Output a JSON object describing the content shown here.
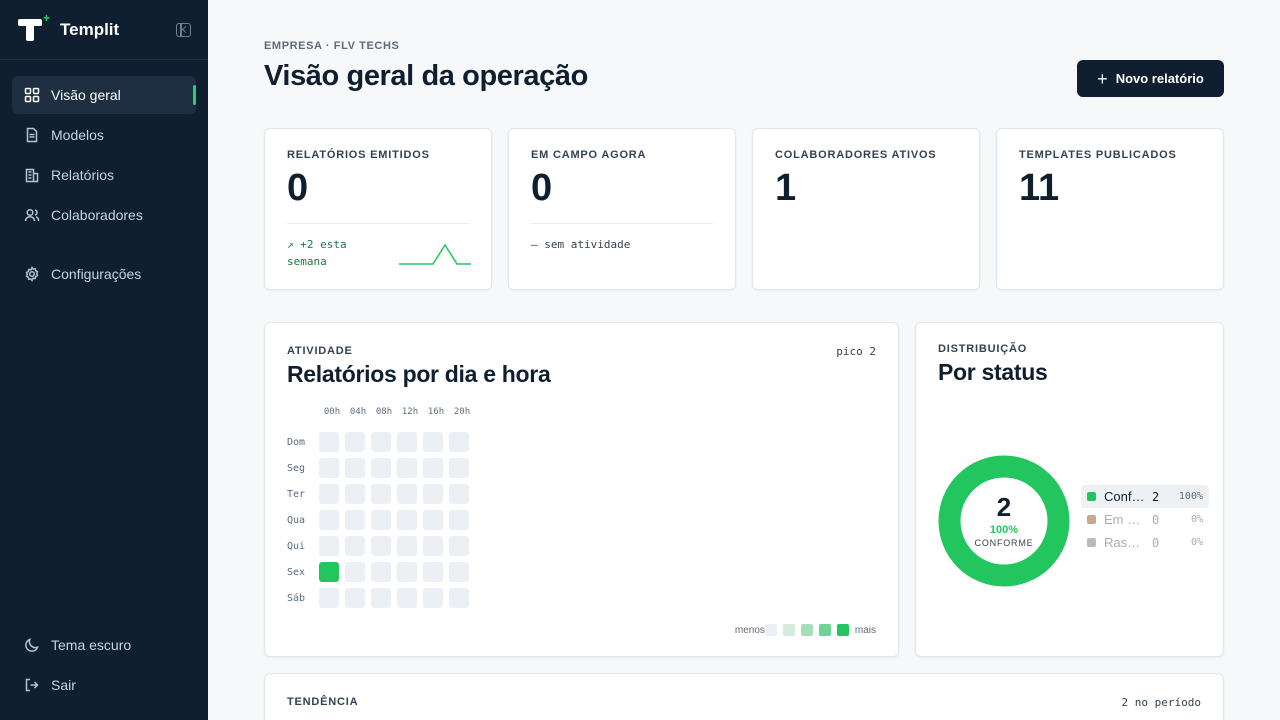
{
  "brand": {
    "name": "Templit"
  },
  "sidebar": {
    "items": [
      {
        "label": "Visão geral",
        "icon": "grid-icon",
        "active": true
      },
      {
        "label": "Modelos",
        "icon": "document-icon"
      },
      {
        "label": "Relatórios",
        "icon": "building-icon"
      },
      {
        "label": "Colaboradores",
        "icon": "users-icon"
      },
      {
        "label": "Configurações",
        "icon": "gear-icon"
      }
    ],
    "bottom": [
      {
        "label": "Tema escuro",
        "icon": "moon-icon"
      },
      {
        "label": "Sair",
        "icon": "logout-icon"
      }
    ]
  },
  "header": {
    "breadcrumb": "EMPRESA · FLV TECHS",
    "title": "Visão geral da operação",
    "new_button": "Novo relatório"
  },
  "kpis": [
    {
      "label": "RELATÓRIOS EMITIDOS",
      "value": "0",
      "foot": "↗ +2 esta semana"
    },
    {
      "label": "EM CAMPO AGORA",
      "value": "0",
      "foot": "— sem atividade"
    },
    {
      "label": "COLABORADORES ATIVOS",
      "value": "1"
    },
    {
      "label": "TEMPLATES PUBLICADOS",
      "value": "11"
    }
  ],
  "activity": {
    "label": "ATIVIDADE",
    "title": "Relatórios por dia e hora",
    "peak": "pico 2",
    "hours": [
      "00h",
      "04h",
      "08h",
      "12h",
      "16h",
      "20h"
    ],
    "days": [
      "Dom",
      "Seg",
      "Ter",
      "Qua",
      "Qui",
      "Sex",
      "Sáb"
    ],
    "legend_less": "menos",
    "legend_more": "mais"
  },
  "distribution": {
    "label": "DISTRIBUIÇÃO",
    "title": "Por status",
    "total": "2",
    "pct": "100%",
    "caption": "CONFORME",
    "statuses": [
      {
        "name": "Conforme",
        "count": "2",
        "pct": "100%",
        "color": "#22c55e"
      },
      {
        "name": "Em campo",
        "count": "0",
        "pct": "0%",
        "color": "#c8a990"
      },
      {
        "name": "Rascunho",
        "count": "0",
        "pct": "0%",
        "color": "#b6bcc3"
      }
    ]
  },
  "trend": {
    "label": "TENDÊNCIA",
    "meta": "2 no período"
  },
  "colors": {
    "accent": "#22c55e",
    "sidebar": "#0f1f30"
  }
}
